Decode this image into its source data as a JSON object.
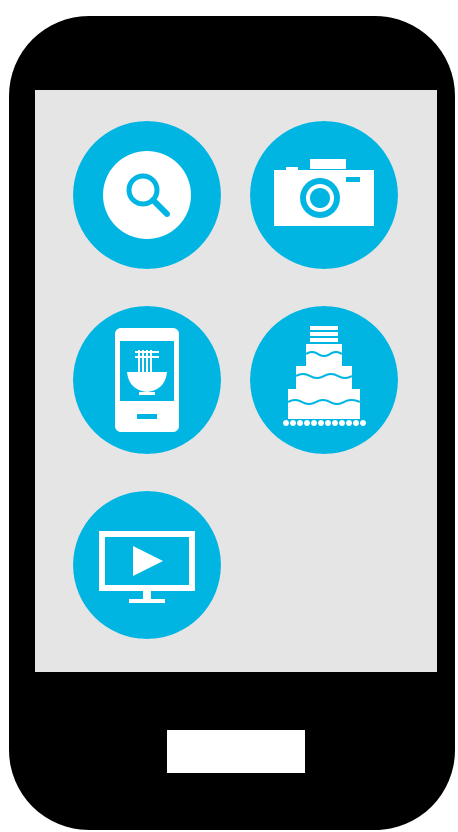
{
  "colors": {
    "phone_body": "#000000",
    "screen_background": "#e5e5e5",
    "icon_background": "#00b5e2",
    "icon_foreground": "#ffffff",
    "home_button": "#ffffff"
  },
  "apps": [
    {
      "icon": "search-icon",
      "label": ""
    },
    {
      "icon": "camera-icon",
      "label": ""
    },
    {
      "icon": "food-order-icon",
      "label": ""
    },
    {
      "icon": "cake-icon",
      "label": ""
    },
    {
      "icon": "video-player-icon",
      "label": ""
    }
  ],
  "home_button": {
    "icon": "home-button"
  }
}
